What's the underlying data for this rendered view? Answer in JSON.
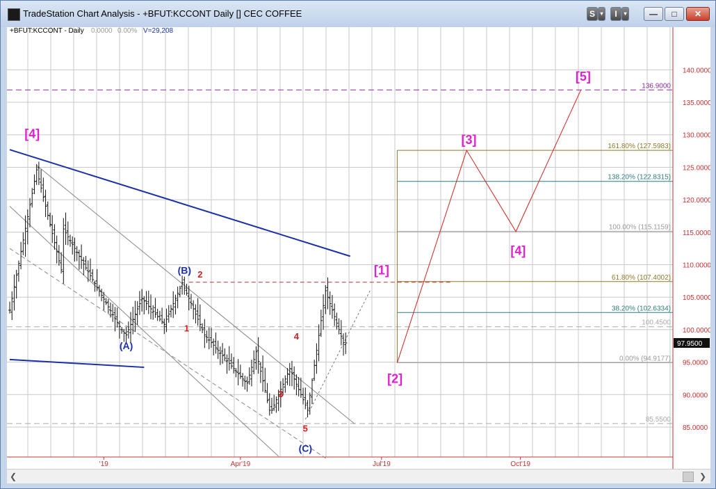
{
  "window": {
    "title": "TradeStation Chart Analysis - +BFUT:KCCONT Daily [] CEC COFFEE",
    "s_button": "S",
    "i_button": "I",
    "dropdown_glyph": "▾",
    "minimize_glyph": "—",
    "maximize_glyph": "□",
    "close_glyph": "✕"
  },
  "header": {
    "symbol": "+BFUT:KCCONT - Daily",
    "value1": "0.0000",
    "value2": "0.00%",
    "volume": "V=29,208"
  },
  "price_axis": {
    "ticks": [
      {
        "v": 140,
        "label": "140.0000"
      },
      {
        "v": 135,
        "label": "135.0000"
      },
      {
        "v": 130,
        "label": "130.0000"
      },
      {
        "v": 125,
        "label": "125.0000"
      },
      {
        "v": 120,
        "label": "120.0000"
      },
      {
        "v": 115,
        "label": "115.0000"
      },
      {
        "v": 110,
        "label": "110.0000"
      },
      {
        "v": 105,
        "label": "105.0000"
      },
      {
        "v": 100,
        "label": "100.0000"
      },
      {
        "v": 95,
        "label": "95.0000"
      },
      {
        "v": 90,
        "label": "90.0000"
      },
      {
        "v": 85,
        "label": "85.0000"
      }
    ],
    "last_price": "97.9500"
  },
  "time_axis": {
    "ticks": [
      {
        "label": "'19",
        "bar": 42
      },
      {
        "label": "Apr'19",
        "bar": 103
      },
      {
        "label": "Jul'19",
        "bar": 166
      },
      {
        "label": "Oct'19",
        "bar": 228
      }
    ]
  },
  "fib_levels": [
    {
      "pct": "161.80%",
      "value": 127.5983,
      "label": "161.80% (127.5983)",
      "color": "#8b7a2b"
    },
    {
      "pct": "138.20%",
      "value": 122.8315,
      "label": "138.20% (122.8315)",
      "color": "#2e7d7d"
    },
    {
      "pct": "100.00%",
      "value": 115.1159,
      "label": "100.00% (115.1159)",
      "color": "#9a9a9a"
    },
    {
      "pct": "61.80%",
      "value": 107.4002,
      "label": "61.80% (107.4002)",
      "color": "#8b7a2b"
    },
    {
      "pct": "38.20%",
      "value": 102.6334,
      "label": "38.20% (102.6334)",
      "color": "#2e7d7d"
    },
    {
      "pct": "0.00%",
      "value": 94.9177,
      "label": "0.00% (94.9177)",
      "color": "#9a9a9a"
    }
  ],
  "horizontal_levels": [
    {
      "value": 136.9,
      "label": "136.9000",
      "color": "#8a2f9c"
    },
    {
      "value": 100.45,
      "label": "100.4500",
      "color": "#aaaaaa"
    },
    {
      "value": 85.55,
      "label": "85.5500",
      "color": "#aaaaaa"
    }
  ],
  "wave_labels": [
    {
      "text": "[4]",
      "bar": 10,
      "price": 129.5,
      "color": "#e020d0",
      "size": 18
    },
    {
      "text": "(B)",
      "bar": 78,
      "price": 108.6,
      "color": "#1a2fa8",
      "size": 14
    },
    {
      "text": "2",
      "bar": 85,
      "price": 108.0,
      "color": "#d42020",
      "size": 13
    },
    {
      "text": "1",
      "bar": 79,
      "price": 99.7,
      "color": "#d42020",
      "size": 13
    },
    {
      "text": "(A)",
      "bar": 52,
      "price": 97.0,
      "color": "#1a2fa8",
      "size": 14
    },
    {
      "text": "4",
      "bar": 128,
      "price": 98.5,
      "color": "#d42020",
      "size": 13
    },
    {
      "text": "3",
      "bar": 121,
      "price": 89.6,
      "color": "#d42020",
      "size": 13
    },
    {
      "text": "5",
      "bar": 132,
      "price": 84.3,
      "color": "#d42020",
      "size": 13
    },
    {
      "text": "(C)",
      "bar": 132,
      "price": 81.2,
      "color": "#1a2fa8",
      "size": 14
    },
    {
      "text": "[1]",
      "bar": 166,
      "price": 108.5,
      "color": "#e020d0",
      "size": 18
    },
    {
      "text": "[2]",
      "bar": 172,
      "price": 91.8,
      "color": "#e020d0",
      "size": 18
    },
    {
      "text": "[3]",
      "bar": 205,
      "price": 128.6,
      "color": "#e020d0",
      "size": 18
    },
    {
      "text": "[4]",
      "bar": 227,
      "price": 111.5,
      "color": "#e020d0",
      "size": 18
    },
    {
      "text": "[5]",
      "bar": 256,
      "price": 138.3,
      "color": "#e020d0",
      "size": 18
    }
  ],
  "projection_path": [
    {
      "bar": 173,
      "price": 94.9
    },
    {
      "bar": 204,
      "price": 127.6
    },
    {
      "bar": 226,
      "price": 115.1
    },
    {
      "bar": 255,
      "price": 136.9
    }
  ],
  "trendlines": [
    {
      "from": {
        "bar": 0,
        "price": 127.7
      },
      "to": {
        "bar": 152,
        "price": 111.3
      },
      "color": "#1a2fa8",
      "width": 2,
      "dash": ""
    },
    {
      "from": {
        "bar": 0,
        "price": 95.4
      },
      "to": {
        "bar": 60,
        "price": 94.2
      },
      "color": "#1a2fa8",
      "width": 2,
      "dash": ""
    },
    {
      "from": {
        "bar": 80,
        "price": 107.3
      },
      "to": {
        "bar": 197,
        "price": 107.3
      },
      "color": "#c83030",
      "width": 1,
      "dash": "6,4"
    },
    {
      "from": {
        "bar": 12,
        "price": 125.3
      },
      "to": {
        "bar": 154,
        "price": 85.5
      },
      "color": "#888888",
      "width": 1,
      "dash": ""
    },
    {
      "from": {
        "bar": 0,
        "price": 119.0
      },
      "to": {
        "bar": 120,
        "price": 80.5
      },
      "color": "#888888",
      "width": 1,
      "dash": ""
    },
    {
      "from": {
        "bar": 0,
        "price": 112.5
      },
      "to": {
        "bar": 142,
        "price": 80.0
      },
      "color": "#888888",
      "width": 1,
      "dash": "6,4"
    },
    {
      "from": {
        "bar": 132,
        "price": 86.2
      },
      "to": {
        "bar": 161,
        "price": 106.1
      },
      "color": "#777777",
      "width": 1,
      "dash": "3,3"
    }
  ],
  "chart_data": {
    "type": "ohlc",
    "series_name": "+BFUT:KCCONT - Daily",
    "y_range": [
      80.5,
      145.5
    ],
    "y_ticks": [
      85,
      90,
      95,
      100,
      105,
      110,
      115,
      120,
      125,
      130,
      135,
      140
    ],
    "x_ticks": [
      "'19",
      "Apr'19",
      "Jul'19",
      "Oct'19"
    ],
    "last": 97.95,
    "closes": [
      103.0,
      104.8,
      106.6,
      108.4,
      110.2,
      112.0,
      113.8,
      115.6,
      117.4,
      119.2,
      121.0,
      122.8,
      124.6,
      123.2,
      121.8,
      120.4,
      119.0,
      117.6,
      116.2,
      114.8,
      113.4,
      112.0,
      110.6,
      109.2,
      115.5,
      114.9,
      114.3,
      113.7,
      113.1,
      112.5,
      111.9,
      111.3,
      110.7,
      110.1,
      109.5,
      108.9,
      108.3,
      107.7,
      107.1,
      106.5,
      105.9,
      105.3,
      104.7,
      104.1,
      103.5,
      102.9,
      102.3,
      101.7,
      101.1,
      100.5,
      100.0,
      99.5,
      99.2,
      100.0,
      100.8,
      101.6,
      102.4,
      103.2,
      104.0,
      104.8,
      104.4,
      104.0,
      103.6,
      103.2,
      102.8,
      102.4,
      102.0,
      101.6,
      101.2,
      100.8,
      101.6,
      102.4,
      103.2,
      104.0,
      104.8,
      105.6,
      106.4,
      107.2,
      106.4,
      105.6,
      104.8,
      104.0,
      103.2,
      102.4,
      101.6,
      100.8,
      100.0,
      99.2,
      98.8,
      98.4,
      98.0,
      97.6,
      97.2,
      96.8,
      96.4,
      96.0,
      95.6,
      95.2,
      94.8,
      94.4,
      94.0,
      93.6,
      93.2,
      92.8,
      92.4,
      92.0,
      91.8,
      93.0,
      94.2,
      95.4,
      96.6,
      95.1,
      93.6,
      92.1,
      90.6,
      89.1,
      87.6,
      87.6,
      88.4,
      89.2,
      90.0,
      90.8,
      91.6,
      92.4,
      93.2,
      94.0,
      93.2,
      92.4,
      91.6,
      90.8,
      90.0,
      89.2,
      88.4,
      87.6,
      89.9,
      92.2,
      94.5,
      96.8,
      99.1,
      101.4,
      103.7,
      106.0,
      105.0,
      104.0,
      103.0,
      102.0,
      101.0,
      100.0,
      99.0,
      98.0,
      97.95
    ]
  }
}
